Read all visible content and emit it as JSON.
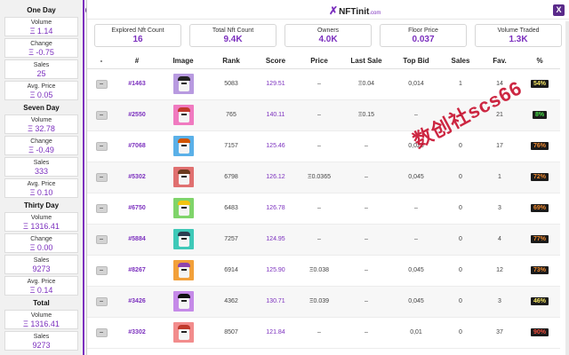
{
  "sidebar": {
    "sections": [
      {
        "title": "One Day",
        "items": [
          {
            "label": "Volume",
            "value": "Ξ 1.14"
          },
          {
            "label": "Change",
            "value": "Ξ -0.75"
          },
          {
            "label": "Sales",
            "value": "25"
          },
          {
            "label": "Avg. Price",
            "value": "Ξ 0.05"
          }
        ]
      },
      {
        "title": "Seven Day",
        "items": [
          {
            "label": "Volume",
            "value": "Ξ 32.78"
          },
          {
            "label": "Change",
            "value": "Ξ -0.49"
          },
          {
            "label": "Sales",
            "value": "333"
          },
          {
            "label": "Avg. Price",
            "value": "Ξ 0.10"
          }
        ]
      },
      {
        "title": "Thirty Day",
        "items": [
          {
            "label": "Volume",
            "value": "Ξ 1316.41"
          },
          {
            "label": "Change",
            "value": "Ξ 0.00"
          },
          {
            "label": "Sales",
            "value": "9273"
          },
          {
            "label": "Avg. Price",
            "value": "Ξ 0.14"
          }
        ]
      },
      {
        "title": "Total",
        "items": [
          {
            "label": "Volume",
            "value": "Ξ 1316.41"
          },
          {
            "label": "Sales",
            "value": "9273"
          }
        ]
      }
    ],
    "collapse_icon": "double-chevron-right-icon",
    "collapse_glyph": "»"
  },
  "header": {
    "brand_glyph": "✗",
    "brand_name": "NFTinit",
    "brand_suffix": ".com",
    "close_glyph": "X",
    "accent": "#7b2fbe"
  },
  "stats": [
    {
      "label": "Explored Nft Count",
      "value": "16"
    },
    {
      "label": "Total Nft Count",
      "value": "9.4K"
    },
    {
      "label": "Owners",
      "value": "4.0K"
    },
    {
      "label": "Floor Price",
      "value": "0.037"
    },
    {
      "label": "Volume Traded",
      "value": "1.3K"
    }
  ],
  "table": {
    "columns": [
      "-",
      "#",
      "Image",
      "Rank",
      "Score",
      "Price",
      "Last Sale",
      "Top Bid",
      "Sales",
      "Fav.",
      "%"
    ],
    "remove_glyph": "−",
    "rows": [
      {
        "id": "#1463",
        "rank": "5083",
        "score": "129.51",
        "price": "–",
        "last_sale": "Ξ0.04",
        "top_bid": "0,014",
        "sales": "1",
        "fav": "14",
        "pct": "54%",
        "pct_color": "#f5e663",
        "img_bg": "#b89ae0",
        "hat": "#222222"
      },
      {
        "id": "#2550",
        "rank": "765",
        "score": "140.11",
        "price": "–",
        "last_sale": "Ξ0.15",
        "top_bid": "–",
        "sales": "1",
        "fav": "21",
        "pct": "8%",
        "pct_color": "#46e046",
        "img_bg": "#f07ac0",
        "hat": "#c0392b"
      },
      {
        "id": "#7068",
        "rank": "7157",
        "score": "125.46",
        "price": "–",
        "last_sale": "–",
        "top_bid": "0,023",
        "sales": "0",
        "fav": "17",
        "pct": "76%",
        "pct_color": "#f08a30",
        "img_bg": "#5ab0e8",
        "hat": "#d35400"
      },
      {
        "id": "#5302",
        "rank": "6798",
        "score": "126.12",
        "price": "Ξ0.0365",
        "last_sale": "–",
        "top_bid": "0,045",
        "sales": "0",
        "fav": "1",
        "pct": "72%",
        "pct_color": "#f08a30",
        "img_bg": "#e07070",
        "hat": "#6b3a1f"
      },
      {
        "id": "#6750",
        "rank": "6483",
        "score": "126.78",
        "price": "–",
        "last_sale": "–",
        "top_bid": "–",
        "sales": "0",
        "fav": "3",
        "pct": "69%",
        "pct_color": "#f08a30",
        "img_bg": "#7fd46a",
        "hat": "#f1c40f"
      },
      {
        "id": "#5884",
        "rank": "7257",
        "score": "124.95",
        "price": "–",
        "last_sale": "–",
        "top_bid": "–",
        "sales": "0",
        "fav": "4",
        "pct": "77%",
        "pct_color": "#f08a30",
        "img_bg": "#3ec9b8",
        "hat": "#2c3e50"
      },
      {
        "id": "#8267",
        "rank": "6914",
        "score": "125.90",
        "price": "Ξ0.038",
        "last_sale": "–",
        "top_bid": "0,045",
        "sales": "0",
        "fav": "12",
        "pct": "73%",
        "pct_color": "#f08a30",
        "img_bg": "#f2a03a",
        "hat": "#8e44ad"
      },
      {
        "id": "#3426",
        "rank": "4362",
        "score": "130.71",
        "price": "Ξ0.039",
        "last_sale": "–",
        "top_bid": "0,045",
        "sales": "0",
        "fav": "3",
        "pct": "46%",
        "pct_color": "#f5e663",
        "img_bg": "#c58ae8",
        "hat": "#111111"
      },
      {
        "id": "#3302",
        "rank": "8507",
        "score": "121.84",
        "price": "–",
        "last_sale": "–",
        "top_bid": "0,01",
        "sales": "0",
        "fav": "37",
        "pct": "90%",
        "pct_color": "#f04a3a",
        "img_bg": "#f28c8c",
        "hat": "#c0392b"
      }
    ]
  },
  "watermark": "数创社scs66"
}
